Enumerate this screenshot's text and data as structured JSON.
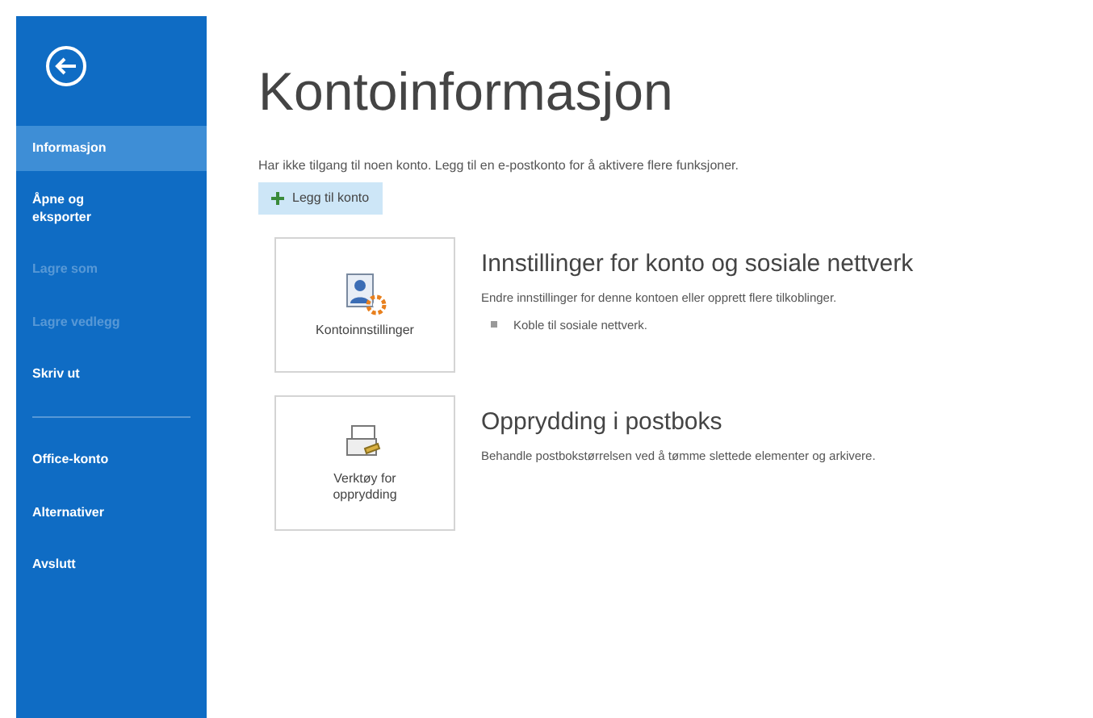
{
  "sidebar": {
    "items": [
      {
        "label": "Informasjon",
        "selected": true,
        "disabled": false
      },
      {
        "label": "Åpne og eksporter",
        "selected": false,
        "disabled": false
      },
      {
        "label": "Lagre som",
        "selected": false,
        "disabled": true
      },
      {
        "label": "Lagre vedlegg",
        "selected": false,
        "disabled": true
      },
      {
        "label": "Skriv ut",
        "selected": false,
        "disabled": false
      },
      {
        "label": "Office-konto",
        "selected": false,
        "disabled": false
      },
      {
        "label": "Alternativer",
        "selected": false,
        "disabled": false
      },
      {
        "label": "Avslutt",
        "selected": false,
        "disabled": false
      }
    ]
  },
  "title": "Kontoinformasjon",
  "notice": "Har ikke tilgang til noen konto. Legg til en e-postkonto for å aktivere flere funksjoner.",
  "add_account_button": "Legg til konto",
  "sections": [
    {
      "kind": "account",
      "button": "Kontoinnstillinger",
      "heading": "Innstillinger for konto og sosiale nettverk",
      "description": "Endre innstillinger for denne kontoen eller opprett flere tilkoblinger.",
      "bullet": "Koble til sosiale nettverk."
    },
    {
      "kind": "cleanup",
      "button": "Verktøy for opprydding",
      "heading": "Opprydding i postboks",
      "description": "Behandle postbokstørrelsen ved å tømme slettede elementer og arkivere."
    }
  ]
}
